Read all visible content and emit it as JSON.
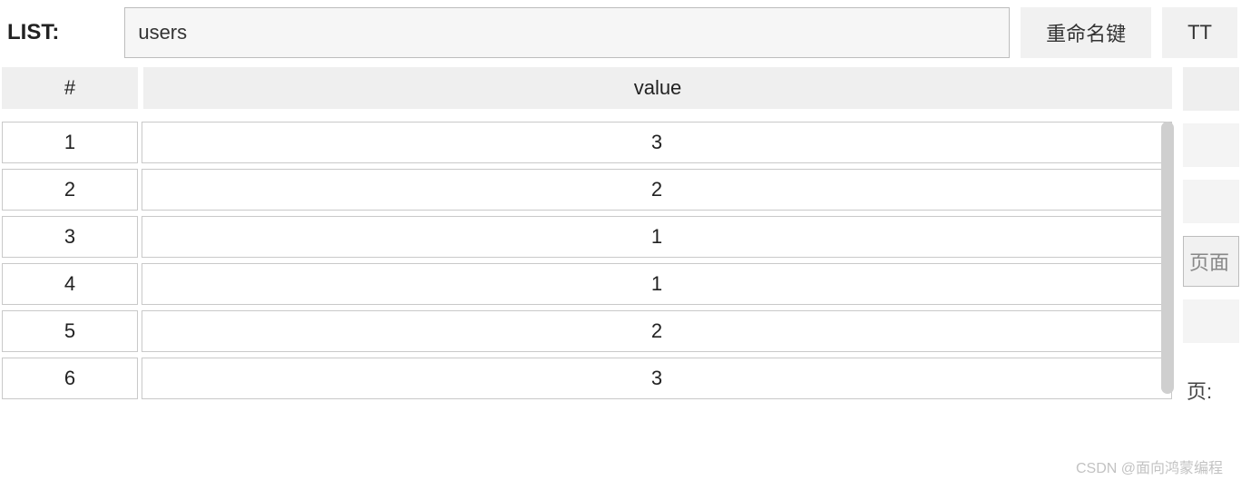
{
  "header": {
    "type_label": "LIST:",
    "key_value": "users",
    "rename_button": "重命名键",
    "tt_button": "TT"
  },
  "table": {
    "columns": {
      "index": "#",
      "value": "value"
    },
    "rows": [
      {
        "index": "1",
        "value": "3"
      },
      {
        "index": "2",
        "value": "2"
      },
      {
        "index": "3",
        "value": "1"
      },
      {
        "index": "4",
        "value": "1"
      },
      {
        "index": "5",
        "value": "2"
      },
      {
        "index": "6",
        "value": "3"
      }
    ]
  },
  "side": {
    "page_button": "页面",
    "page_label": "页:"
  },
  "watermark": "CSDN @面向鸿蒙编程"
}
